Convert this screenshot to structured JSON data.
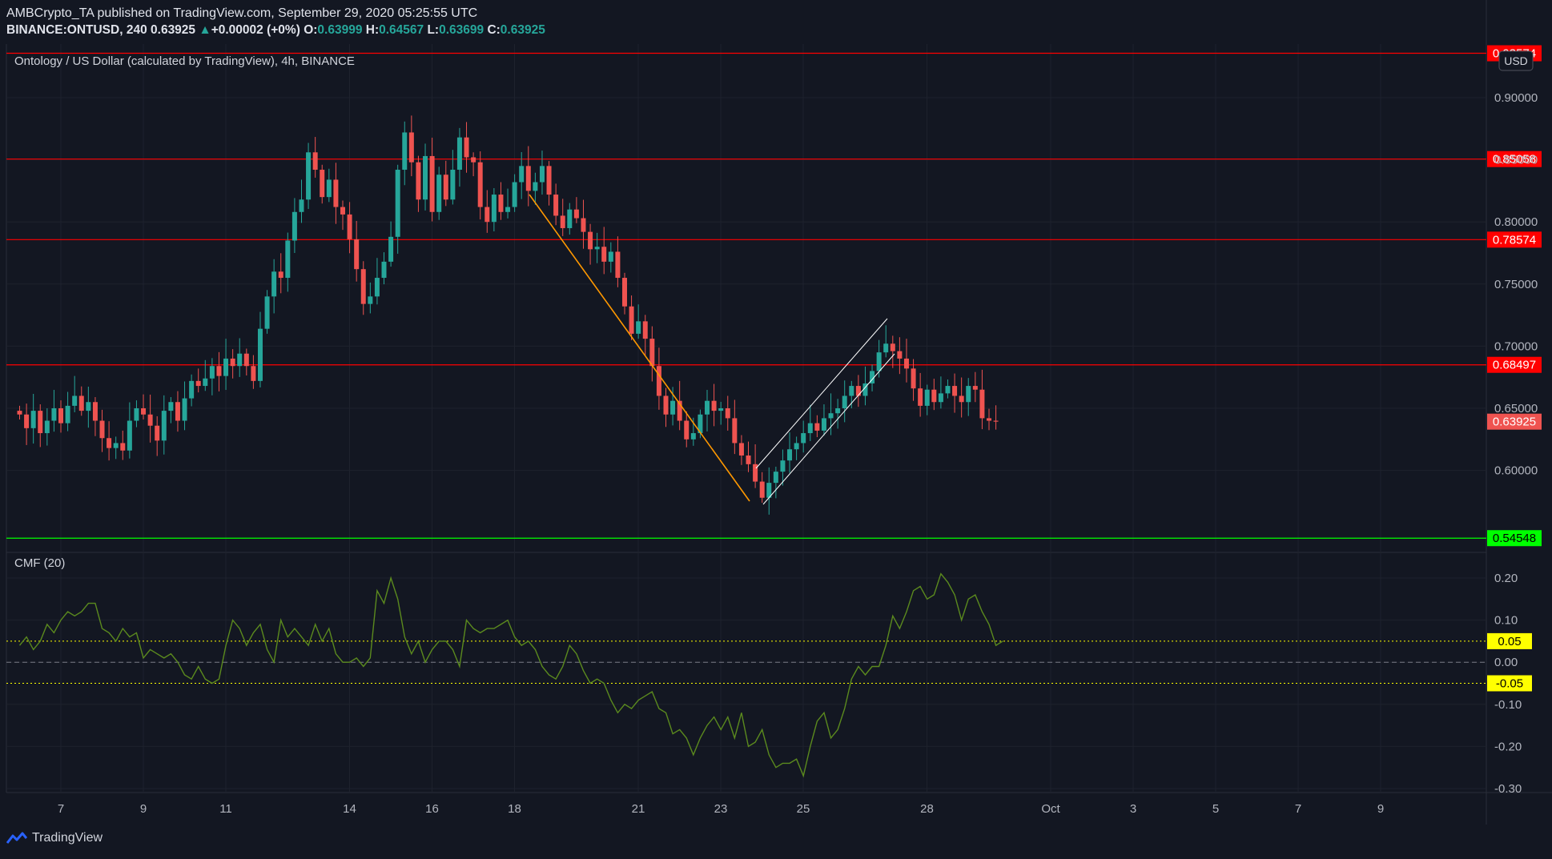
{
  "header": {
    "line1": "AMBCrypto_TA published on TradingView.com, September 29, 2020 05:25:55 UTC",
    "symbol": "BINANCE:ONTUSD, 240",
    "last": "0.63925",
    "change": "+0.00002 (+0%)",
    "o_label": "O:",
    "o": "0.63999",
    "h_label": "H:",
    "h": "0.64567",
    "l_label": "L:",
    "l": "0.63699",
    "c_label": "C:",
    "c": "0.63925"
  },
  "chart_title": "Ontology / US Dollar (calculated by TradingView), 4h, BINANCE",
  "currency_badge": "USD",
  "indicator_title": "CMF (20)",
  "footer": {
    "brand": "TradingView"
  },
  "colors": {
    "background": "#131722",
    "up": "#26a69a",
    "down": "#ef5350",
    "resistance": "#ff0000",
    "support": "#00ff00",
    "cmf": "#5b8a1e",
    "cmf_band": "#ffff00",
    "trendline": "#ff9800",
    "channel": "#ffffff"
  },
  "chart_data": [
    {
      "type": "candlestick",
      "ylim": [
        0.545,
        0.935
      ],
      "price_ticks": [
        "0.90000",
        "0.85000",
        "0.80000",
        "0.75000",
        "0.70000",
        "0.65000",
        "0.60000"
      ],
      "x_ticks": [
        {
          "label": "7",
          "day": 7
        },
        {
          "label": "9",
          "day": 9
        },
        {
          "label": "11",
          "day": 11
        },
        {
          "label": "14",
          "day": 14
        },
        {
          "label": "16",
          "day": 16
        },
        {
          "label": "18",
          "day": 18
        },
        {
          "label": "21",
          "day": 21
        },
        {
          "label": "23",
          "day": 23
        },
        {
          "label": "25",
          "day": 25
        },
        {
          "label": "28",
          "day": 28
        },
        {
          "label": "Oct",
          "day": 31
        },
        {
          "label": "3",
          "day": 33
        },
        {
          "label": "5",
          "day": 35
        },
        {
          "label": "7",
          "day": 37
        },
        {
          "label": "9",
          "day": 39
        }
      ],
      "horizontal_levels": [
        {
          "value": 0.93574,
          "label": "0.93574",
          "color": "#ff0000"
        },
        {
          "value": 0.85058,
          "label": "0.85058",
          "color": "#ff0000"
        },
        {
          "value": 0.78574,
          "label": "0.78574",
          "color": "#ff0000"
        },
        {
          "value": 0.68497,
          "label": "0.68497",
          "color": "#ff0000"
        },
        {
          "value": 0.54548,
          "label": "0.54548",
          "color": "#00ff00"
        }
      ],
      "last_price": {
        "value": 0.63925,
        "label": "0.63925"
      },
      "candles_start_day": 6.0,
      "candle_interval_days": 0.1667,
      "closes": [
        0.645,
        0.634,
        0.648,
        0.63,
        0.64,
        0.65,
        0.638,
        0.652,
        0.66,
        0.648,
        0.655,
        0.64,
        0.626,
        0.618,
        0.622,
        0.616,
        0.64,
        0.65,
        0.645,
        0.636,
        0.624,
        0.648,
        0.655,
        0.64,
        0.658,
        0.672,
        0.668,
        0.674,
        0.684,
        0.676,
        0.69,
        0.684,
        0.694,
        0.684,
        0.672,
        0.714,
        0.74,
        0.76,
        0.755,
        0.785,
        0.808,
        0.818,
        0.856,
        0.842,
        0.82,
        0.834,
        0.812,
        0.806,
        0.786,
        0.762,
        0.734,
        0.74,
        0.755,
        0.768,
        0.788,
        0.842,
        0.872,
        0.848,
        0.818,
        0.853,
        0.808,
        0.838,
        0.818,
        0.842,
        0.868,
        0.852,
        0.848,
        0.812,
        0.8,
        0.822,
        0.808,
        0.812,
        0.832,
        0.845,
        0.825,
        0.832,
        0.845,
        0.822,
        0.805,
        0.795,
        0.81,
        0.803,
        0.792,
        0.778,
        0.78,
        0.768,
        0.776,
        0.755,
        0.732,
        0.71,
        0.72,
        0.706,
        0.684,
        0.66,
        0.645,
        0.656,
        0.64,
        0.625,
        0.63,
        0.645,
        0.656,
        0.648,
        0.65,
        0.642,
        0.622,
        0.612,
        0.605,
        0.591,
        0.578,
        0.59,
        0.599,
        0.608,
        0.617,
        0.622,
        0.63,
        0.638,
        0.632,
        0.642,
        0.646,
        0.65,
        0.66,
        0.668,
        0.66,
        0.67,
        0.68,
        0.695,
        0.702,
        0.696,
        0.69,
        0.682,
        0.666,
        0.652,
        0.665,
        0.655,
        0.662,
        0.668,
        0.66,
        0.655,
        0.668,
        0.665,
        0.642,
        0.64,
        0.63925
      ]
    },
    {
      "type": "line",
      "title": "CMF (20)",
      "ylim": [
        -0.3,
        0.22
      ],
      "y_ticks": [
        "0.20",
        "0.10",
        "0.00",
        "-0.10",
        "-0.20",
        "-0.30"
      ],
      "bands": [
        {
          "value": 0.05,
          "label": "0.05"
        },
        {
          "value": -0.05,
          "label": "-0.05"
        }
      ],
      "x_start_day": 6.0,
      "x_interval_days": 0.1667,
      "values": [
        0.04,
        0.06,
        0.03,
        0.05,
        0.09,
        0.07,
        0.1,
        0.12,
        0.11,
        0.12,
        0.14,
        0.14,
        0.08,
        0.07,
        0.05,
        0.08,
        0.06,
        0.07,
        0.01,
        0.03,
        0.02,
        0.01,
        0.02,
        0.0,
        -0.03,
        -0.04,
        -0.01,
        -0.04,
        -0.05,
        -0.04,
        0.04,
        0.1,
        0.08,
        0.04,
        0.07,
        0.09,
        0.03,
        0.0,
        0.1,
        0.06,
        0.08,
        0.06,
        0.04,
        0.09,
        0.05,
        0.08,
        0.02,
        -0.0,
        0.0,
        0.01,
        -0.01,
        0.01,
        0.17,
        0.14,
        0.2,
        0.15,
        0.06,
        0.02,
        0.05,
        -0.0,
        0.03,
        0.05,
        0.05,
        0.03,
        -0.01,
        0.1,
        0.08,
        0.07,
        0.08,
        0.08,
        0.09,
        0.1,
        0.06,
        0.04,
        0.05,
        0.03,
        -0.01,
        -0.03,
        -0.04,
        -0.01,
        0.04,
        0.02,
        -0.02,
        -0.05,
        -0.04,
        -0.05,
        -0.09,
        -0.12,
        -0.1,
        -0.11,
        -0.09,
        -0.08,
        -0.07,
        -0.11,
        -0.12,
        -0.17,
        -0.16,
        -0.18,
        -0.22,
        -0.18,
        -0.15,
        -0.13,
        -0.16,
        -0.13,
        -0.18,
        -0.12,
        -0.2,
        -0.19,
        -0.16,
        -0.22,
        -0.25,
        -0.24,
        -0.24,
        -0.23,
        -0.27,
        -0.2,
        -0.14,
        -0.12,
        -0.18,
        -0.16,
        -0.11,
        -0.04,
        -0.01,
        -0.03,
        -0.01,
        -0.01,
        0.04,
        0.11,
        0.08,
        0.12,
        0.17,
        0.18,
        0.15,
        0.16,
        0.21,
        0.19,
        0.16,
        0.1,
        0.15,
        0.16,
        0.12,
        0.09,
        0.04,
        0.05
      ]
    }
  ]
}
